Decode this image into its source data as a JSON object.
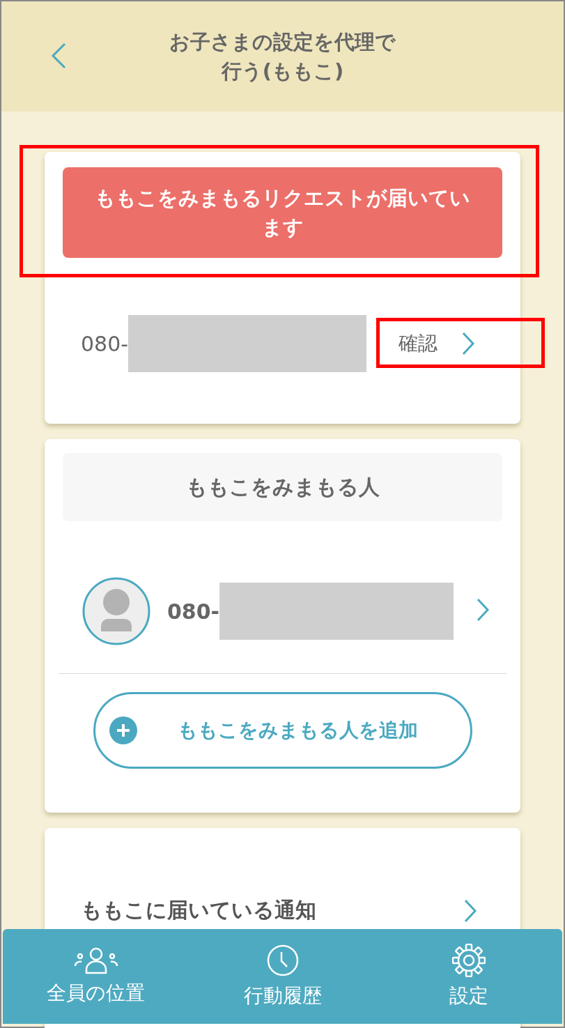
{
  "header": {
    "title_lines": [
      "お子さまの設定を代理で",
      "行う(ももこ)"
    ]
  },
  "request_card": {
    "banner": "ももこをみまもるリクエストが届いています",
    "banner_highlighted": true,
    "phone": "080-",
    "confirm_link": "確認",
    "confirm_highlighted": true
  },
  "watchers_card": {
    "heading": "ももこをみまもる人",
    "watchers": [
      {
        "phone": "080-"
      }
    ],
    "add_button": "ももこをみまもる人を追加"
  },
  "notifications_card": {
    "item": "ももこに届いている通知"
  },
  "bottom_nav": [
    {
      "label": "全員の位置"
    },
    {
      "label": "行動履歴"
    },
    {
      "label": "設定"
    }
  ]
}
